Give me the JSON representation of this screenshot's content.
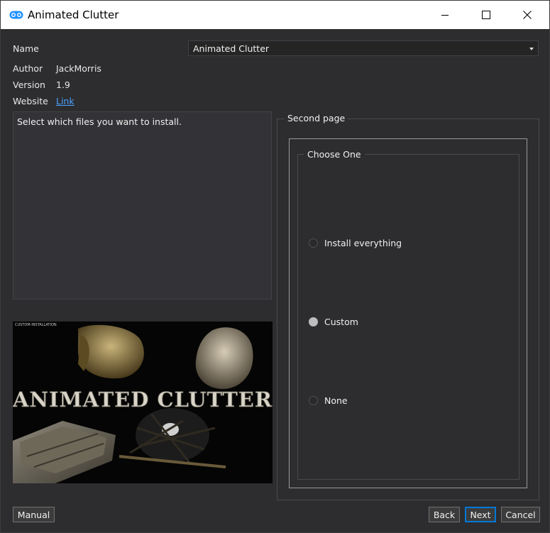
{
  "window": {
    "title": "Animated Clutter",
    "icon": "app-logo-icon"
  },
  "titlebar_buttons": {
    "minimize": "minimize-icon",
    "maximize": "maximize-icon",
    "close": "close-icon"
  },
  "info": {
    "name_label": "Name",
    "name_value": "Animated Clutter",
    "author_label": "Author",
    "author_value": "JackMorris",
    "version_label": "Version",
    "version_value": "1.9",
    "website_label": "Website",
    "website_link": "Link"
  },
  "description": "Select which files you want to install.",
  "preview": {
    "caption": "CUSTOM INSTALLATION",
    "logo_text": "ANIMATED CLUTTER"
  },
  "page": {
    "title": "Second page",
    "group_title": "Choose One",
    "options": [
      {
        "label": "Install everything",
        "selected": false
      },
      {
        "label": "Custom",
        "selected": true
      },
      {
        "label": "None",
        "selected": false
      }
    ]
  },
  "buttons": {
    "manual": "Manual",
    "back": "Back",
    "next": "Next",
    "cancel": "Cancel"
  },
  "colors": {
    "background": "#2d2d30",
    "link": "#4aa3ff",
    "accent": "#0078d7"
  }
}
